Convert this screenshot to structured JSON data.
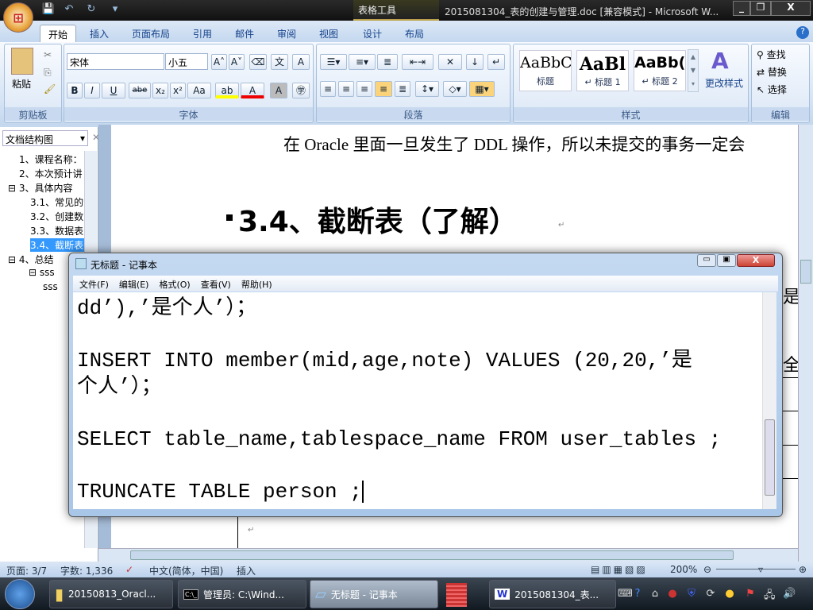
{
  "word": {
    "title": "2015081304_表的创建与管理.doc [兼容模式] - Microsoft W...",
    "context_tool": "表格工具",
    "office_button": "⊞",
    "window_controls": {
      "minimize": "_",
      "restore": "❐",
      "close": "X"
    },
    "tabs": [
      "开始",
      "插入",
      "页面布局",
      "引用",
      "邮件",
      "审阅",
      "视图",
      "设计",
      "布局"
    ],
    "ribbon": {
      "clipboard": {
        "label": "剪贴板",
        "paste": "粘贴"
      },
      "font": {
        "label": "字体",
        "font_name": "宋体",
        "font_size": "小五",
        "bold": "B",
        "italic": "I",
        "underline": "U",
        "strike": "abe",
        "sub": "x₂",
        "sup": "x²",
        "case": "Aa",
        "grow": "A˄",
        "shrink": "A˅",
        "char_shade": "A",
        "enclose": "㊫"
      },
      "paragraph": {
        "label": "段落"
      },
      "styles": {
        "label": "样式",
        "items": [
          {
            "sample": "AaBbC",
            "name": "标题"
          },
          {
            "sample": "AaBl",
            "name": "↵ 标题 1"
          },
          {
            "sample": "AaBb(",
            "name": "↵ 标题 2"
          }
        ],
        "change": "更改样式"
      },
      "editing": {
        "label": "编辑",
        "find": "查找",
        "replace": "替换",
        "select": "选择"
      }
    },
    "nav": {
      "title": "文档结构图",
      "items": [
        {
          "text": "1、课程名称：",
          "level": 1
        },
        {
          "text": "2、本次预计讲",
          "level": 1
        },
        {
          "text": "⊟ 3、具体内容",
          "level": 0
        },
        {
          "text": "3.1、常见的",
          "level": 2
        },
        {
          "text": "3.2、创建数",
          "level": 2
        },
        {
          "text": "3.3、数据表",
          "level": 2
        },
        {
          "text": "3.4、截断表",
          "level": 2,
          "selected": true
        },
        {
          "text": "⊟ 4、总结",
          "level": 0
        },
        {
          "text": "⊟ sss",
          "level": 3
        },
        {
          "text": "sss",
          "level": 4
        }
      ]
    },
    "document": {
      "line1": "在 Oracle 里面一旦发生了 DDL 操作，所以未提交的事务一定会",
      "heading": "3.4、截断表（了解）",
      "para_mark": "↵",
      "right_frag1": "是",
      "right_frag2": "全"
    },
    "status": {
      "page": "页面: 3/7",
      "words": "字数: 1,336",
      "language": "中文(简体，中国)",
      "mode": "插入",
      "zoom": "200%"
    }
  },
  "notepad": {
    "title": "无标题 - 记事本",
    "menu": [
      "文件(F)",
      "编辑(E)",
      "格式(O)",
      "查看(V)",
      "帮助(H)"
    ],
    "lines": [
      "dd’),’是个人’）；",
      "",
      "INSERT INTO member(mid,age,note) VALUES (20,20,’是",
      "个人’）；",
      "",
      "SELECT table_name,tablespace_name FROM user_tables ;",
      "",
      "TRUNCATE TABLE person ;"
    ]
  },
  "taskbar": {
    "items": [
      "20150813_Oracl...",
      "管理员: C:\\Wind...",
      "无标题 - 记事本",
      "",
      "2015081304_表..."
    ]
  }
}
